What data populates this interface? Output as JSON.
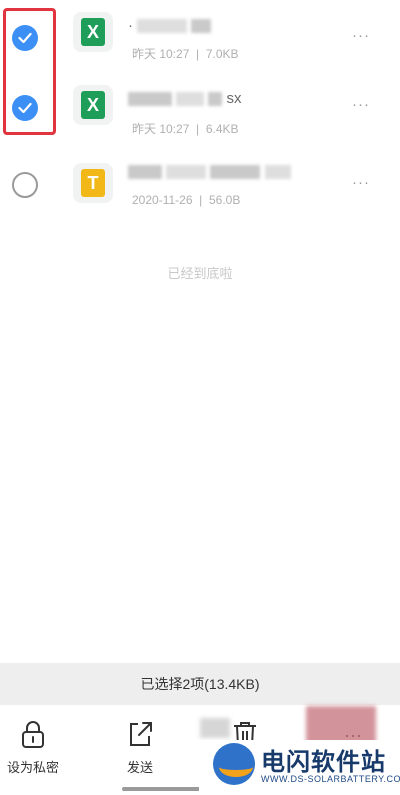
{
  "files": [
    {
      "name_visible": "·",
      "name_suffix": "",
      "date": "昨天 10:27",
      "size": "7.0KB",
      "type": "excel",
      "icon_letter": "X",
      "selected": true
    },
    {
      "name_visible": "",
      "name_suffix": "sx",
      "date": "昨天 10:27",
      "size": "6.4KB",
      "type": "excel",
      "icon_letter": "X",
      "selected": true
    },
    {
      "name_visible": "",
      "name_suffix": "",
      "date": "2020-11-26",
      "size": "56.0B",
      "type": "text",
      "icon_letter": "T",
      "selected": false
    }
  ],
  "meta_separator": "|",
  "more_glyph": "···",
  "list_end_text": "已经到底啦",
  "selection_summary": "已选择2项(13.4KB)",
  "actions": {
    "private_label": "设为私密",
    "send_label": "发送",
    "more_glyph": "···"
  },
  "watermark": {
    "title": "电闪软件站",
    "subtitle": "WWW.DS-SOLARBATTERY.COM"
  },
  "colors": {
    "accent": "#3b8ff5",
    "excel": "#1e9e58",
    "text_file": "#f2b818",
    "highlight": "#e2343f"
  }
}
